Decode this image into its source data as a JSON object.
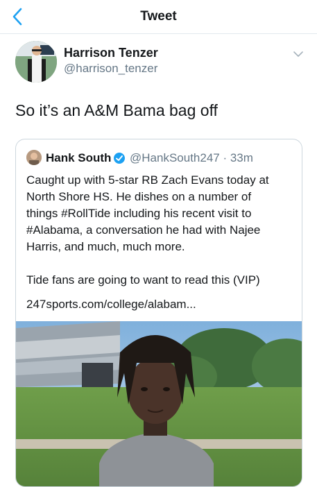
{
  "nav": {
    "title": "Tweet"
  },
  "tweet": {
    "author_name": "Harrison Tenzer",
    "author_handle": "@harrison_tenzer",
    "text": "So it’s an A&M Bama bag off"
  },
  "quoted": {
    "author_name": "Hank South",
    "author_handle": "@HankSouth247",
    "time_sep": " · ",
    "time": "33m",
    "body_lines": [
      "Caught up with 5-star RB Zach Evans today at",
      "North Shore HS. He dishes on a number of",
      "things #RollTide including his recent visit to",
      "#Alabama, a conversation he had with Najee",
      "Harris, and much, much more."
    ],
    "body_line2": "Tide fans are going to want to read this (VIP)",
    "link": "247sports.com/college/alabam..."
  },
  "colors": {
    "accent": "#1da1f2",
    "secondary_text": "#657786",
    "border": "#ccd6dd"
  },
  "icons": {
    "back": "chevron-left-icon",
    "more": "chevron-down-icon",
    "verified": "verified-badge-icon"
  }
}
